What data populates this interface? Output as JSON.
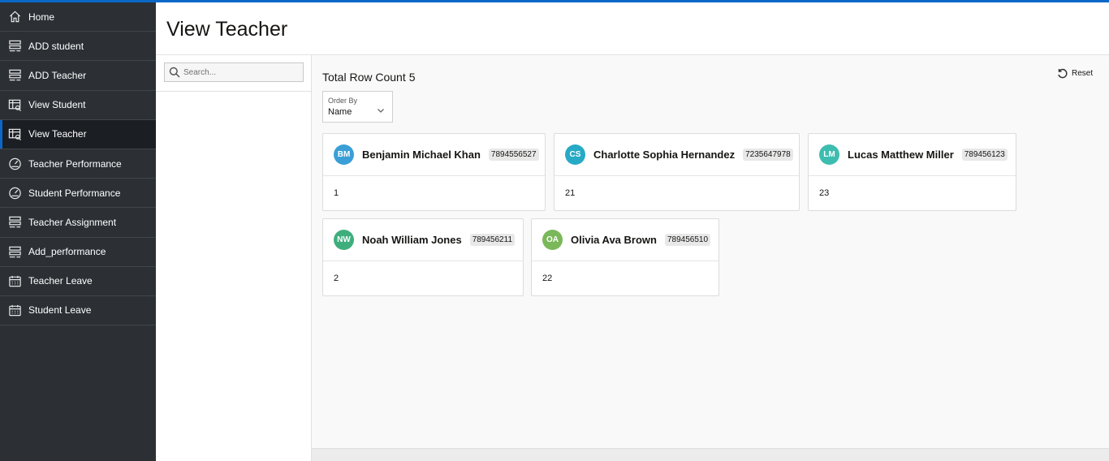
{
  "sidebar": {
    "items": [
      {
        "label": "Home",
        "icon": "home-icon",
        "active": false
      },
      {
        "label": "ADD student",
        "icon": "form-icon",
        "active": false
      },
      {
        "label": "ADD Teacher",
        "icon": "form-icon",
        "active": false
      },
      {
        "label": "View Student",
        "icon": "table-search-icon",
        "active": false
      },
      {
        "label": "View Teacher",
        "icon": "table-search-icon",
        "active": true
      },
      {
        "label": "Teacher Performance",
        "icon": "gauge-icon",
        "active": false
      },
      {
        "label": "Student Performance",
        "icon": "gauge-icon",
        "active": false
      },
      {
        "label": "Teacher Assignment",
        "icon": "form-icon",
        "active": false
      },
      {
        "label": "Add_performance",
        "icon": "form-icon",
        "active": false
      },
      {
        "label": "Teacher Leave",
        "icon": "calendar-icon",
        "active": false
      },
      {
        "label": "Student Leave",
        "icon": "calendar-icon",
        "active": false
      }
    ]
  },
  "header": {
    "title": "View Teacher"
  },
  "search": {
    "placeholder": "Search..."
  },
  "results": {
    "count_label": "Total Row Count",
    "count": "5",
    "reset_label": "Reset",
    "order_by": {
      "label": "Order By",
      "value": "Name"
    }
  },
  "cards": [
    {
      "initials": "BM",
      "name": "Benjamin Michael Khan",
      "phone": "7894556527",
      "value": "1",
      "color": "#3a9fd6"
    },
    {
      "initials": "CS",
      "name": "Charlotte Sophia Hernandez",
      "phone": "7235647978",
      "value": "21",
      "color": "#27aac6"
    },
    {
      "initials": "LM",
      "name": "Lucas Matthew Miller",
      "phone": "789456123",
      "value": "23",
      "color": "#3dbdb0"
    },
    {
      "initials": "NW",
      "name": "Noah William Jones",
      "phone": "789456211",
      "value": "2",
      "color": "#3fae7d"
    },
    {
      "initials": "OA",
      "name": "Olivia Ava Brown",
      "phone": "789456510",
      "value": "22",
      "color": "#7ab85a"
    }
  ],
  "colors": {
    "accent": "#0b67c7",
    "sidebar_bg": "#2c3035",
    "sidebar_active_bg": "#1b1e22"
  }
}
